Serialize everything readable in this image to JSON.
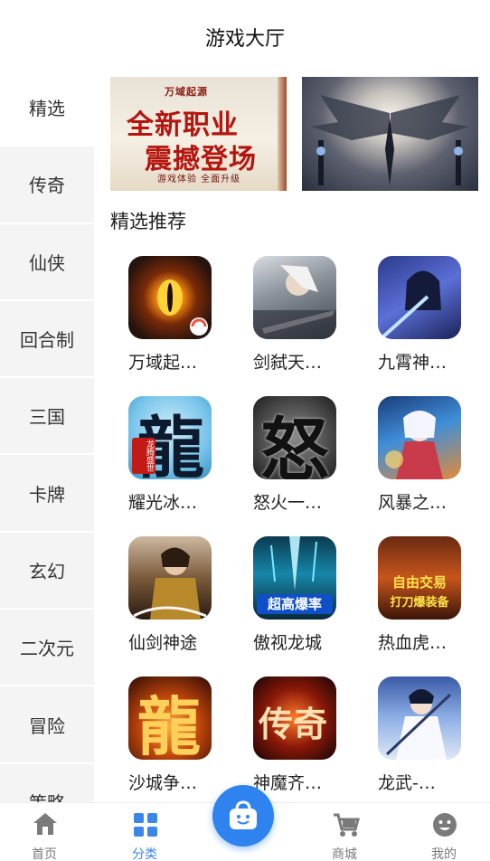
{
  "header": {
    "title": "游戏大厅"
  },
  "sidebar": {
    "items": [
      {
        "label": "精选",
        "active": true
      },
      {
        "label": "传奇"
      },
      {
        "label": "仙侠"
      },
      {
        "label": "回合制"
      },
      {
        "label": "三国"
      },
      {
        "label": "卡牌"
      },
      {
        "label": "玄幻"
      },
      {
        "label": "二次元"
      },
      {
        "label": "冒险"
      },
      {
        "label": "策略"
      }
    ]
  },
  "banners": [
    {
      "tag": "万域起源",
      "line1": "全新职业",
      "line2": "震撼登场",
      "sub": "游戏体验 全面升级"
    },
    {
      "tag": ""
    }
  ],
  "section": {
    "title": "精选推荐"
  },
  "games": [
    {
      "name": "万域起…",
      "icon": "eye-dragon"
    },
    {
      "name": "剑弑天…",
      "icon": "sword-warrior"
    },
    {
      "name": "九霄神…",
      "icon": "xianxia-hero"
    },
    {
      "name": "耀光冰…",
      "icon": "long-calligraphy",
      "icon_text": "龍",
      "badge": "龙腾盛世"
    },
    {
      "name": "怒火一…",
      "icon": "nu-calligraphy",
      "icon_text": "怒"
    },
    {
      "name": "风暴之…",
      "icon": "anime-girl"
    },
    {
      "name": "仙剑神途",
      "icon": "armored-hero"
    },
    {
      "name": "傲视龙城",
      "icon": "blue-strike",
      "icon_text": "超高爆率"
    },
    {
      "name": "热血虎…",
      "icon": "trade-promo",
      "icon_text": "自由交易",
      "icon_text2": "打刀爆装备"
    },
    {
      "name": "沙城争…",
      "icon": "fire-long",
      "icon_text": "龍"
    },
    {
      "name": "神魔齐…",
      "icon": "chuanqi-seal",
      "icon_text": "传奇"
    },
    {
      "name": "龙武-…",
      "icon": "white-swordsman"
    }
  ],
  "tabbar": {
    "items": [
      {
        "label": "首页",
        "icon": "home-icon"
      },
      {
        "label": "分类",
        "icon": "grid-icon",
        "active": true
      },
      {
        "label": "",
        "icon": "shopping-bag-icon"
      },
      {
        "label": "商城",
        "icon": "cart-icon"
      },
      {
        "label": "我的",
        "icon": "profile-icon"
      }
    ]
  },
  "colors": {
    "accent": "#2f83ef",
    "sidebar_bg": "#f4f4f4",
    "banner_red": "#b5150e"
  }
}
